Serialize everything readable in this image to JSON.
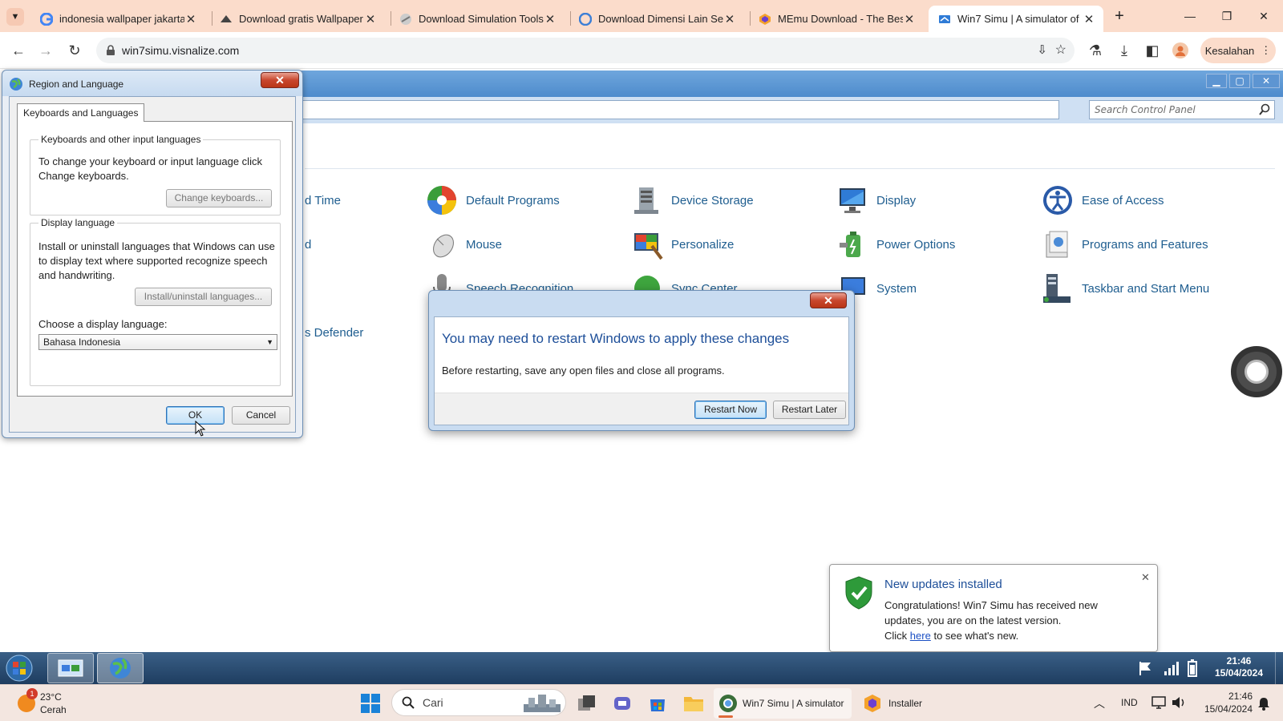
{
  "browser": {
    "tabs": [
      {
        "title": "indonesia wallpaper jakarta",
        "icon": "google-icon"
      },
      {
        "title": "Download gratis Wallpaper",
        "icon": "site-icon"
      },
      {
        "title": "Download Simulation Tools",
        "icon": "site-icon"
      },
      {
        "title": "Download Dimensi Lain Ser",
        "icon": "site-icon"
      },
      {
        "title": "MEmu Download - The Best",
        "icon": "memu-icon"
      },
      {
        "title": "Win7 Simu | A simulator of",
        "icon": "win7simu-icon"
      }
    ],
    "active_tab_index": 5,
    "url": "win7simu.visnalize.com",
    "profile_label": "Kesalahan"
  },
  "control_panel": {
    "search_placeholder": "Search Control Panel",
    "fragments": {
      "time": "d Time",
      "d": "d",
      "defender": "s Defender"
    },
    "items": [
      {
        "label": "Default Programs",
        "icon": "default-programs-icon"
      },
      {
        "label": "Device Storage",
        "icon": "device-storage-icon"
      },
      {
        "label": "Display",
        "icon": "display-icon"
      },
      {
        "label": "Ease of Access",
        "icon": "ease-of-access-icon"
      },
      {
        "label": "Mouse",
        "icon": "mouse-icon"
      },
      {
        "label": "Personalize",
        "icon": "personalize-icon"
      },
      {
        "label": "Power Options",
        "icon": "power-options-icon"
      },
      {
        "label": "Programs and Features",
        "icon": "programs-features-icon"
      },
      {
        "label": "Speech Recognition",
        "icon": "speech-icon"
      },
      {
        "label": "Sync Center",
        "icon": "sync-icon"
      },
      {
        "label": "System",
        "icon": "system-icon"
      },
      {
        "label": "Taskbar and Start Menu",
        "icon": "taskbar-icon"
      }
    ]
  },
  "region_dialog": {
    "title": "Region and Language",
    "tab_label": "Keyboards and Languages",
    "kb_group_label": "Keyboards and other input languages",
    "kb_text": "To change your keyboard or input language click Change keyboards.",
    "change_keyboards": "Change keyboards...",
    "display_group_label": "Display language",
    "display_text": "Install or uninstall languages that Windows can use to display text where supported recognize speech and handwriting.",
    "install_button": "Install/uninstall languages...",
    "choose_label": "Choose a display language:",
    "selected_language": "Bahasa Indonesia",
    "ok": "OK",
    "cancel": "Cancel"
  },
  "restart_dialog": {
    "heading": "You may need to restart Windows to apply these changes",
    "text": "Before restarting, save any open files and close all programs.",
    "restart_now": "Restart Now",
    "restart_later": "Restart Later"
  },
  "notification": {
    "title": "New updates installed",
    "line1": "Congratulations! Win7 Simu has received new",
    "line2": "updates, you are on the latest version.",
    "click": "Click",
    "link": "here",
    "rest": "to see what's new."
  },
  "win7_taskbar": {
    "time": "21:46",
    "date": "15/04/2024"
  },
  "win11_taskbar": {
    "weather_temp": "23°C",
    "weather_cond": "Cerah",
    "weather_badge": "1",
    "search_placeholder": "Cari",
    "app1": "Win7 Simu | A simulator",
    "app2": "Installer",
    "lang": "IND",
    "time": "21:46",
    "date": "15/04/2024"
  },
  "colors": {
    "accent_link": "#1e5d8f",
    "tab_strip": "#fbdccb",
    "close_red": "#c8472e"
  }
}
